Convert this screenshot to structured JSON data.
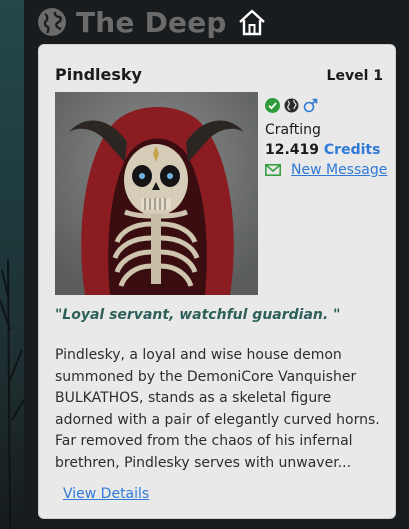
{
  "header": {
    "title": "The Deep",
    "globe_icon": "globe-icon",
    "home_icon": "home-icon"
  },
  "card": {
    "name": "Pindlesky",
    "level": "Level 1",
    "status_icons": [
      "check-circle-icon",
      "globe-icon",
      "male-icon"
    ],
    "activity": "Crafting",
    "credits_amount": "12.419",
    "credits_label": "Credits",
    "new_message_label": "New Message",
    "motto": "\"Loyal servant, watchful guardian. \"",
    "description": "Pindlesky, a loyal and wise house demon summoned by the DemoniCore Vanquisher BULKATHOS, stands as a skeletal figure adorned with a pair of elegantly curved horns. Far removed from the chaos of his infernal brethren, Pindlesky serves with unwaver...",
    "view_details_label": "View Details"
  },
  "colors": {
    "accent": "#2f7ad8",
    "motto": "#2f5f5a",
    "status_green": "#2e9b3a"
  }
}
